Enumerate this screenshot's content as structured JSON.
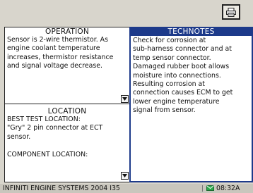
{
  "toolbar": {
    "print_icon": "printer-icon"
  },
  "operation": {
    "title": "OPERATION",
    "lines": [
      "Sensor is 2-wire thermistor. As",
      "engine coolant temperature",
      "increases, thermistor resistance",
      "and signal voltage decrease."
    ]
  },
  "location": {
    "title": "LOCATION",
    "lines": [
      "BEST TEST LOCATION:",
      "\"Gry\" 2 pin connector at ECT",
      "sensor.",
      "",
      "COMPONENT LOCATION:"
    ]
  },
  "technotes": {
    "title": "TECHNOTES",
    "lines": [
      "Check for corrosion at",
      "sub-harness connector and at",
      "temp sensor connector.",
      "Damaged rubber boot allows",
      "moisture into connections.",
      "Resulting corrosion at",
      "connection causes ECM to get",
      "lower engine temperature",
      "signal from sensor."
    ]
  },
  "statusbar": {
    "title": "INFINITI ENGINE SYSTEMS 2004 I35",
    "time": "08:32A",
    "accent_color": "#1d3a8a",
    "mail_icon": "mail-icon"
  }
}
